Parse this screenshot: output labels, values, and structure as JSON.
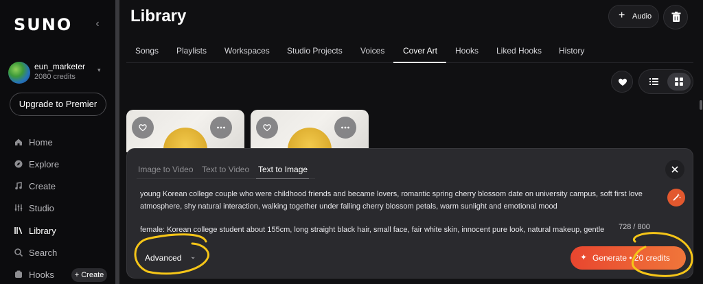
{
  "sidebar": {
    "logo": "SUNO",
    "user": {
      "name": "eun_marketer",
      "credits": "2080 credits"
    },
    "upgrade_label": "Upgrade to Premier",
    "nav": [
      {
        "label": "Home",
        "icon": "home-icon"
      },
      {
        "label": "Explore",
        "icon": "compass-icon"
      },
      {
        "label": "Create",
        "icon": "music-note-icon"
      },
      {
        "label": "Studio",
        "icon": "studio-icon"
      },
      {
        "label": "Library",
        "icon": "library-icon",
        "active": true
      },
      {
        "label": "Search",
        "icon": "search-icon"
      },
      {
        "label": "Hooks",
        "icon": "hooks-icon"
      }
    ],
    "create_pill": "+ Create"
  },
  "header": {
    "title": "Library",
    "audio_button": "Audio"
  },
  "tabs": [
    "Songs",
    "Playlists",
    "Workspaces",
    "Studio Projects",
    "Voices",
    "Cover Art",
    "Hooks",
    "Liked Hooks",
    "History"
  ],
  "active_tab": "Cover Art",
  "panel": {
    "tabs": [
      "Image to Video",
      "Text to Video",
      "Text to Image"
    ],
    "active_tab": "Text to Image",
    "prompt_paragraph_1": "young Korean college couple who were childhood friends and became lovers, romantic spring cherry blossom date on university campus, soft first love atmosphere, shy natural interaction, walking together under falling cherry blossom petals, warm sunlight and emotional mood",
    "prompt_paragraph_2": "female: Korean college student about 155cm, long straight black hair, small face, fair white skin, innocent pure look, natural makeup, gentle",
    "counter": "728 / 800",
    "advanced_label": "Advanced",
    "generate_label": "Generate • 20 credits"
  },
  "colors": {
    "accent": "#e8462f",
    "highlight_annotation": "#f5c518",
    "background": "#101012",
    "panel": "#2a2a2e"
  }
}
